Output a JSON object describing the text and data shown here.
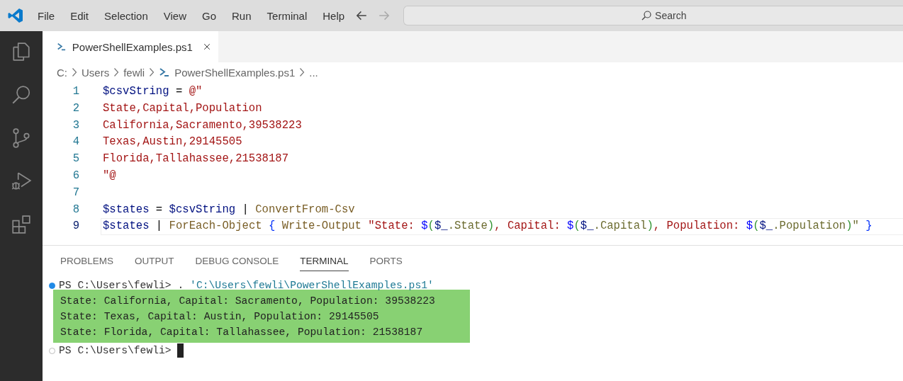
{
  "menu": [
    "File",
    "Edit",
    "Selection",
    "View",
    "Go",
    "Run",
    "Terminal",
    "Help"
  ],
  "search": {
    "placeholder": "Search"
  },
  "activity_bar": [
    {
      "kind": "files",
      "selected": false
    },
    {
      "kind": "search",
      "selected": false
    },
    {
      "kind": "source-control",
      "selected": false
    },
    {
      "kind": "debug",
      "selected": false
    },
    {
      "kind": "extensions",
      "selected": false
    }
  ],
  "tabs": [
    {
      "label": "PowerShellExamples.ps1",
      "selected": true
    }
  ],
  "breadcrumb": [
    {
      "label": "C:",
      "kind": "text"
    },
    {
      "label": "Users",
      "kind": "text"
    },
    {
      "label": "fewli",
      "kind": "text"
    },
    {
      "label": "PowerShellExamples.ps1",
      "kind": "file"
    },
    {
      "label": "...",
      "kind": "text"
    }
  ],
  "code": [
    {
      "number": "1",
      "current": false,
      "tokens": [
        {
          "kind": "var",
          "text": "$csvString"
        },
        {
          "kind": "plain",
          "text": " = "
        },
        {
          "kind": "str",
          "text": "@\""
        }
      ]
    },
    {
      "number": "2",
      "current": false,
      "tokens": [
        {
          "kind": "str",
          "text": "State,Capital,Population"
        }
      ]
    },
    {
      "number": "3",
      "current": false,
      "tokens": [
        {
          "kind": "str",
          "text": "California,Sacramento,39538223"
        }
      ]
    },
    {
      "number": "4",
      "current": false,
      "tokens": [
        {
          "kind": "str",
          "text": "Texas,Austin,29145505"
        }
      ]
    },
    {
      "number": "5",
      "current": false,
      "tokens": [
        {
          "kind": "str",
          "text": "Florida,Tallahassee,21538187"
        }
      ]
    },
    {
      "number": "6",
      "current": false,
      "tokens": [
        {
          "kind": "str",
          "text": "\"@"
        }
      ]
    },
    {
      "number": "7",
      "current": false
    },
    {
      "number": "8",
      "current": false,
      "tokens": [
        {
          "kind": "var",
          "text": "$states"
        },
        {
          "kind": "plain",
          "text": " = "
        },
        {
          "kind": "var",
          "text": "$csvString"
        },
        {
          "kind": "plain",
          "text": " | "
        },
        {
          "kind": "cmd",
          "text": "ConvertFrom-Csv"
        }
      ]
    },
    {
      "number": "9",
      "current": true,
      "tokens": [
        {
          "kind": "var",
          "text": "$states"
        },
        {
          "kind": "plain",
          "text": " | "
        },
        {
          "kind": "cmd",
          "text": "ForEach-Object "
        },
        {
          "kind": "brace",
          "text": "{ "
        },
        {
          "kind": "cmd",
          "text": "Write-Output "
        },
        {
          "kind": "str",
          "text": "\"State: "
        },
        {
          "kind": "sub",
          "text": "$"
        },
        {
          "kind": "paren",
          "text": "("
        },
        {
          "kind": "var",
          "text": "$_"
        },
        {
          "kind": "member",
          "text": ".State"
        },
        {
          "kind": "paren",
          "text": ")"
        },
        {
          "kind": "str",
          "text": ", Capital: "
        },
        {
          "kind": "sub",
          "text": "$"
        },
        {
          "kind": "paren",
          "text": "("
        },
        {
          "kind": "var",
          "text": "$_"
        },
        {
          "kind": "member",
          "text": ".Capital"
        },
        {
          "kind": "paren",
          "text": ")"
        },
        {
          "kind": "str",
          "text": ", Population: "
        },
        {
          "kind": "sub",
          "text": "$"
        },
        {
          "kind": "paren",
          "text": "("
        },
        {
          "kind": "var",
          "text": "$_"
        },
        {
          "kind": "member",
          "text": ".Population"
        },
        {
          "kind": "paren",
          "text": ")"
        },
        {
          "kind": "member",
          "text": "\" "
        },
        {
          "kind": "brace",
          "text": "}"
        }
      ]
    }
  ],
  "panel_tabs": [
    {
      "label": "PROBLEMS",
      "selected": false
    },
    {
      "label": "OUTPUT",
      "selected": false
    },
    {
      "label": "DEBUG CONSOLE",
      "selected": false
    },
    {
      "label": "TERMINAL",
      "selected": true
    },
    {
      "label": "PORTS",
      "selected": false
    }
  ],
  "terminal": [
    {
      "kind": "prompt",
      "succeeded": true,
      "prompt": "PS C:\\Users\\fewli>",
      "command": ".",
      "argument": "'C:\\Users\\fewli\\PowerShellExamples.ps1'",
      "cursor": false
    },
    {
      "kind": "output",
      "highlighted": true,
      "lines": [
        "State: California, Capital: Sacramento, Population: 39538223",
        "State: Texas, Capital: Austin, Population: 29145505",
        "State: Florida, Capital: Tallahassee, Population: 21538187"
      ]
    },
    {
      "kind": "prompt",
      "succeeded": false,
      "prompt": "PS C:\\Users\\fewli>",
      "cursor": true
    }
  ]
}
